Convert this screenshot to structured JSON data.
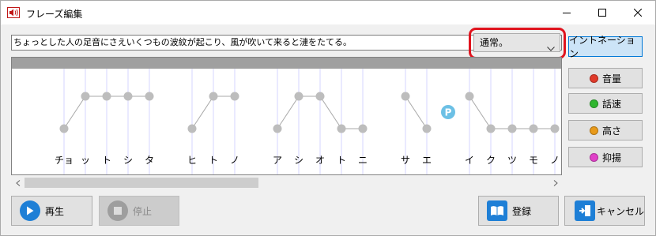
{
  "window": {
    "title": "フレーズ編集"
  },
  "phrase_text": "ちょっとした人の足音にさえいくつもの波紋が起こり、風が吹いて来ると漣をたてる。",
  "voice_style": {
    "selected": "通常。"
  },
  "side_tabs": [
    {
      "label": "イントネーション",
      "active": true,
      "icon": "none"
    },
    {
      "label": "音量",
      "icon": "volume-dot-icon",
      "color": "#e03a2a"
    },
    {
      "label": "話速",
      "icon": "speed-dot-icon",
      "color": "#2fb62f"
    },
    {
      "label": "高さ",
      "icon": "pitch-dot-icon",
      "color": "#e89a1a"
    },
    {
      "label": "抑揚",
      "icon": "intonation-dot-icon",
      "color": "#e040c8"
    }
  ],
  "intonation": {
    "kana": [
      "チョ",
      "ッ",
      "ト",
      "シ",
      "タ",
      "ヒ",
      "ト",
      "ノ",
      "ア",
      "シ",
      "オ",
      "ト",
      "ニ",
      "サ",
      "エ",
      "イ",
      "ク",
      "ツ",
      "モ",
      "ノ"
    ],
    "levels": [
      "low",
      "high",
      "high",
      "high",
      "high",
      "low",
      "high",
      "high",
      "low",
      "high",
      "high",
      "low",
      "low",
      "high",
      "low",
      "high",
      "low",
      "low",
      "low",
      "low"
    ],
    "pause_marker": "P",
    "pause_color": "#6cc0e5"
  },
  "buttons": {
    "play": "再生",
    "stop": "停止",
    "register": "登録",
    "cancel": "キャンセル"
  },
  "colors": {
    "play_icon": "#1e7fd6",
    "highlight": "#e0141e",
    "active_tab": "#cce4f7"
  }
}
